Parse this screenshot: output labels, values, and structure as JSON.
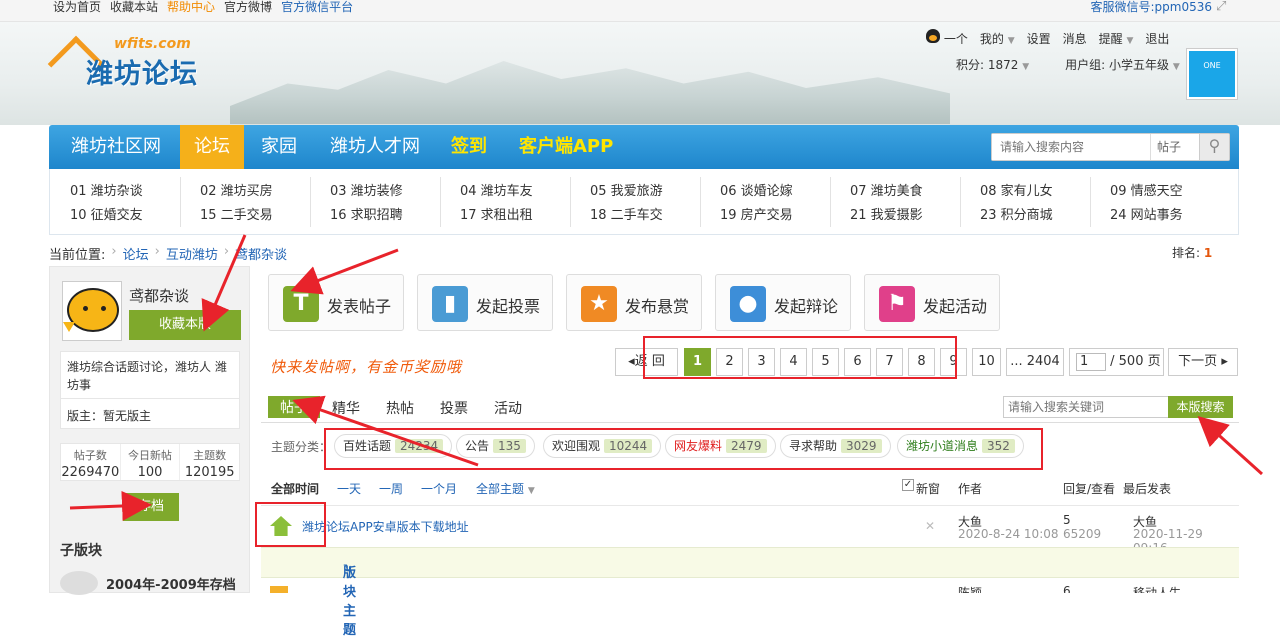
{
  "topbar": {
    "links": [
      "设为首页",
      "收藏本站",
      "帮助中心",
      "官方微博",
      "官方微信平台"
    ],
    "wechat": "客服微信号:ppm0536"
  },
  "logo": {
    "en": "wfits.com",
    "cn": "潍坊论坛"
  },
  "user": {
    "name": "一个",
    "menu": [
      "我的",
      "设置",
      "消息",
      "提醒",
      "退出"
    ],
    "score": "积分: 1872",
    "group": "用户组: 小学五年级",
    "avatar_text": "ONE"
  },
  "nav": {
    "items": [
      "潍坊社区网",
      "论坛",
      "家园",
      "潍坊人才网",
      "签到",
      "客户端APP"
    ],
    "search_placeholder": "请输入搜索内容",
    "search_type": "帖子"
  },
  "subnav": [
    [
      "01 潍坊杂谈",
      "10 征婚交友"
    ],
    [
      "02 潍坊买房",
      "15 二手交易"
    ],
    [
      "03 潍坊装修",
      "16 求职招聘"
    ],
    [
      "04 潍坊车友",
      "17 求租出租"
    ],
    [
      "05 我爱旅游",
      "18 二手车交"
    ],
    [
      "06 谈婚论嫁",
      "19 房产交易"
    ],
    [
      "07 潍坊美食",
      "21 我爱摄影"
    ],
    [
      "08 家有儿女",
      "23 积分商城"
    ],
    [
      "09 情感天空",
      "24 网站事务"
    ]
  ],
  "breadcrumb": {
    "label": "当前位置:",
    "items": [
      "论坛",
      "互动潍坊",
      "鸢都杂谈"
    ]
  },
  "rank": {
    "label": "排名:",
    "value": "1"
  },
  "forum": {
    "name": "鸢都杂谈",
    "fav_button": "收藏本版",
    "description": "潍坊综合话题讨论，潍坊人 潍坊事",
    "moderator": "版主：暂无版主",
    "stats": [
      {
        "label": "帖子数",
        "value": "2269470"
      },
      {
        "label": "今日新帖",
        "value": "100"
      },
      {
        "label": "主题数",
        "value": "120195"
      }
    ],
    "archive_button": "存档",
    "subforum_title": "子版块",
    "subforum_item": "2004年-2009年存档"
  },
  "post_buttons": [
    {
      "label": "发表帖子",
      "icon": "T",
      "color": "#7fa92c"
    },
    {
      "label": "发起投票",
      "icon": "▮",
      "color": "#4a9bd4"
    },
    {
      "label": "发布悬赏",
      "icon": "★",
      "color": "#f08a24"
    },
    {
      "label": "发起辩论",
      "icon": "●",
      "color": "#3d8ed8"
    },
    {
      "label": "发起活动",
      "icon": "⚑",
      "color": "#e0408a"
    }
  ],
  "hint": "快来发帖啊，有金币奖励哦",
  "pager": {
    "back": "返 回",
    "pages": [
      "1",
      "2",
      "3",
      "4",
      "5",
      "6",
      "7",
      "8",
      "9",
      "10"
    ],
    "last": "... 2404",
    "input_value": "1",
    "total": "/ 500 页",
    "next": "下一页"
  },
  "tabs": [
    "帖子",
    "精华",
    "热帖",
    "投票",
    "活动"
  ],
  "board_search": {
    "placeholder": "请输入搜索关键词",
    "button": "本版搜索"
  },
  "topic_types": {
    "label": "主题分类：",
    "items": [
      {
        "name": "百姓话题",
        "count": "24234"
      },
      {
        "name": "公告",
        "count": "135"
      },
      {
        "name": "欢迎围观",
        "count": "10244"
      },
      {
        "name": "网友爆料",
        "count": "2479"
      },
      {
        "name": "寻求帮助",
        "count": "3029"
      },
      {
        "name": "潍坊小道消息",
        "count": "352"
      }
    ]
  },
  "filters": [
    "全部时间",
    "一天",
    "一周",
    "一个月",
    "全部主题"
  ],
  "columns": {
    "new_window": "新窗",
    "author": "作者",
    "replies": "回复/查看",
    "last": "最后发表"
  },
  "threads": [
    {
      "title": "潍坊论坛APP安卓版本下载地址",
      "author": "大鱼",
      "date": "2020-8-24 10:08",
      "replies": "5",
      "views": "65209",
      "last_user": "大鱼",
      "last_date": "2020-11-29 09:16"
    }
  ],
  "section_header": "版块主题",
  "partial_row": {
    "author": "陈颖",
    "replies": "6",
    "last_user": "移动人生"
  },
  "colors": {
    "accent": "#7fa92c",
    "nav": "#1e86cc",
    "active_nav": "#f5b01a",
    "annotation": "#e8232b"
  }
}
